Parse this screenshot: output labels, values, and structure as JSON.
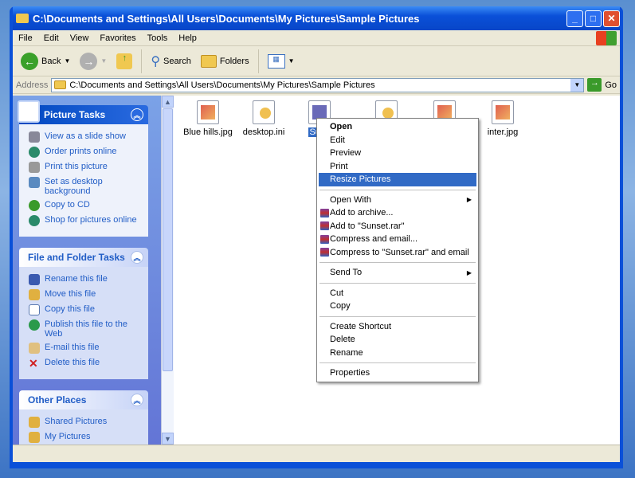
{
  "window": {
    "title": "C:\\Documents and Settings\\All Users\\Documents\\My Pictures\\Sample Pictures"
  },
  "menubar": [
    "File",
    "Edit",
    "View",
    "Favorites",
    "Tools",
    "Help"
  ],
  "toolbar": {
    "back": "Back",
    "search": "Search",
    "folders": "Folders"
  },
  "address": {
    "label": "Address",
    "value": "C:\\Documents and Settings\\All Users\\Documents\\My Pictures\\Sample Pictures",
    "go": "Go"
  },
  "panels": [
    {
      "title": "Picture Tasks",
      "items": [
        "View as a slide show",
        "Order prints online",
        "Print this picture",
        "Set as desktop background",
        "Copy to CD",
        "Shop for pictures online"
      ]
    },
    {
      "title": "File and Folder Tasks",
      "items": [
        "Rename this file",
        "Move this file",
        "Copy this file",
        "Publish this file to the Web",
        "E-mail this file",
        "Delete this file"
      ]
    },
    {
      "title": "Other Places",
      "items": [
        "Shared Pictures",
        "My Pictures"
      ]
    }
  ],
  "files": [
    "Blue hills.jpg",
    "desktop.ini",
    "Suns",
    "inter.jpg"
  ],
  "context_menu": {
    "items": [
      "Open",
      "Edit",
      "Preview",
      "Print",
      "Resize Pictures",
      "Open With",
      "Add to archive...",
      "Add to \"Sunset.rar\"",
      "Compress and email...",
      "Compress to \"Sunset.rar\" and email",
      "Send To",
      "Cut",
      "Copy",
      "Create Shortcut",
      "Delete",
      "Rename",
      "Properties"
    ]
  }
}
